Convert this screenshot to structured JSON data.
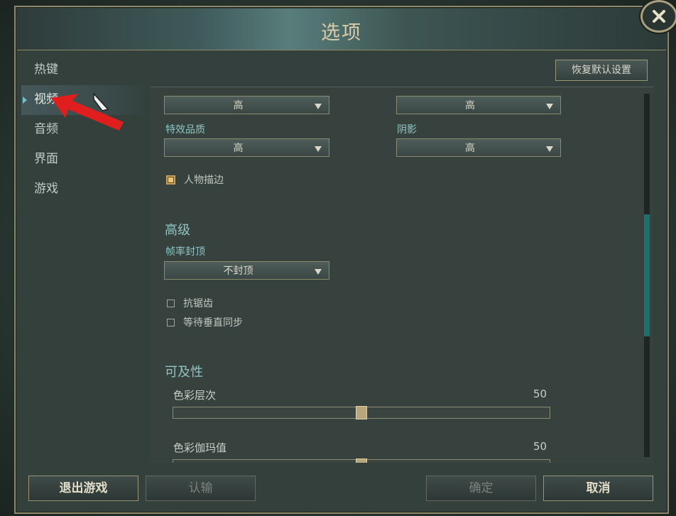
{
  "dialog": {
    "title": "选项"
  },
  "sidebar": {
    "items": [
      {
        "label": "热键"
      },
      {
        "label": "视频",
        "active": true
      },
      {
        "label": "音频"
      },
      {
        "label": "界面"
      },
      {
        "label": "游戏"
      }
    ]
  },
  "toolbar": {
    "reset_label": "恢复默认设置"
  },
  "video": {
    "dropdown_top_left": "高",
    "dropdown_top_right": "高",
    "effects_label": "特效品质",
    "effects_value": "高",
    "shadow_label": "阴影",
    "shadow_value": "高",
    "character_outline_label": "人物描边",
    "character_outline_checked": true
  },
  "advanced": {
    "title": "高级",
    "frame_cap_label": "帧率封顶",
    "frame_cap_value": "不封顶",
    "antialias_label": "抗锯齿",
    "antialias_checked": false,
    "vsync_label": "等待垂直同步",
    "vsync_checked": false
  },
  "accessibility": {
    "title": "可及性",
    "color_depth_label": "色彩层次",
    "color_depth_value": "50",
    "color_depth_fraction": 0.5,
    "color_gamma_label": "色彩伽玛值",
    "color_gamma_value": "50",
    "color_gamma_fraction": 0.5
  },
  "footer": {
    "quit_label": "退出游戏",
    "surrender_label": "认输",
    "confirm_label": "确定",
    "cancel_label": "取消"
  },
  "colors": {
    "accent": "#8fc4c3",
    "border_gold": "#9a9574",
    "highlight": "#72c0c8"
  },
  "icons": {
    "close": "close-icon",
    "active_nav": "chevron-right-icon",
    "annotation": "red-arrow-icon",
    "cursor": "mouse-cursor-icon"
  }
}
